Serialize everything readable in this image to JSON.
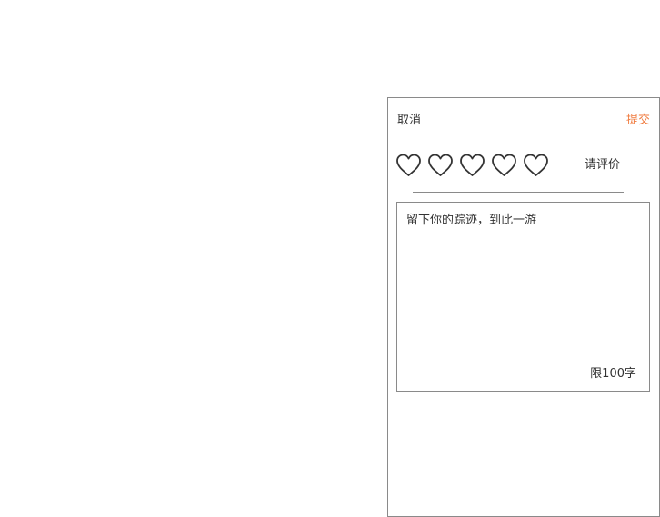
{
  "dialog": {
    "cancel_label": "取消",
    "submit_label": "提交",
    "rating_hint": "请评价",
    "rating": 0,
    "rating_max": 5,
    "comment_placeholder": "留下你的踪迹，到此一游",
    "char_limit_label": "限100字"
  },
  "colors": {
    "accent": "#f07b3f",
    "text": "#333333",
    "border": "#8a8a8a"
  },
  "icons": {
    "star_icon": "heart-outline-icon"
  }
}
